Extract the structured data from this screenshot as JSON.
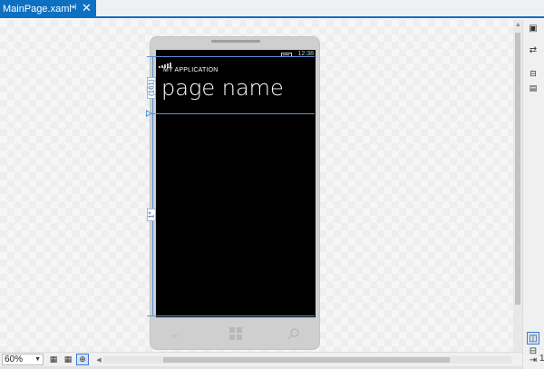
{
  "tab": {
    "title": "MainPage.xaml*",
    "pin_icon": "pin-icon",
    "close_icon": "close-icon"
  },
  "phone": {
    "clock": "12:38",
    "app_title": "MY APPLICATION",
    "page_title": "page name",
    "nav": [
      "back-arrow-icon",
      "windows-logo-icon",
      "search-icon"
    ]
  },
  "grid": {
    "row1_label": "(161)",
    "row2_label": "1*"
  },
  "bottom_toolbar": {
    "zoom": "60%"
  },
  "right_toolbar": {
    "page_number": "1"
  },
  "colors": {
    "accent": "#0e70c0",
    "guide": "#5b93d3",
    "screen": "#000000"
  }
}
